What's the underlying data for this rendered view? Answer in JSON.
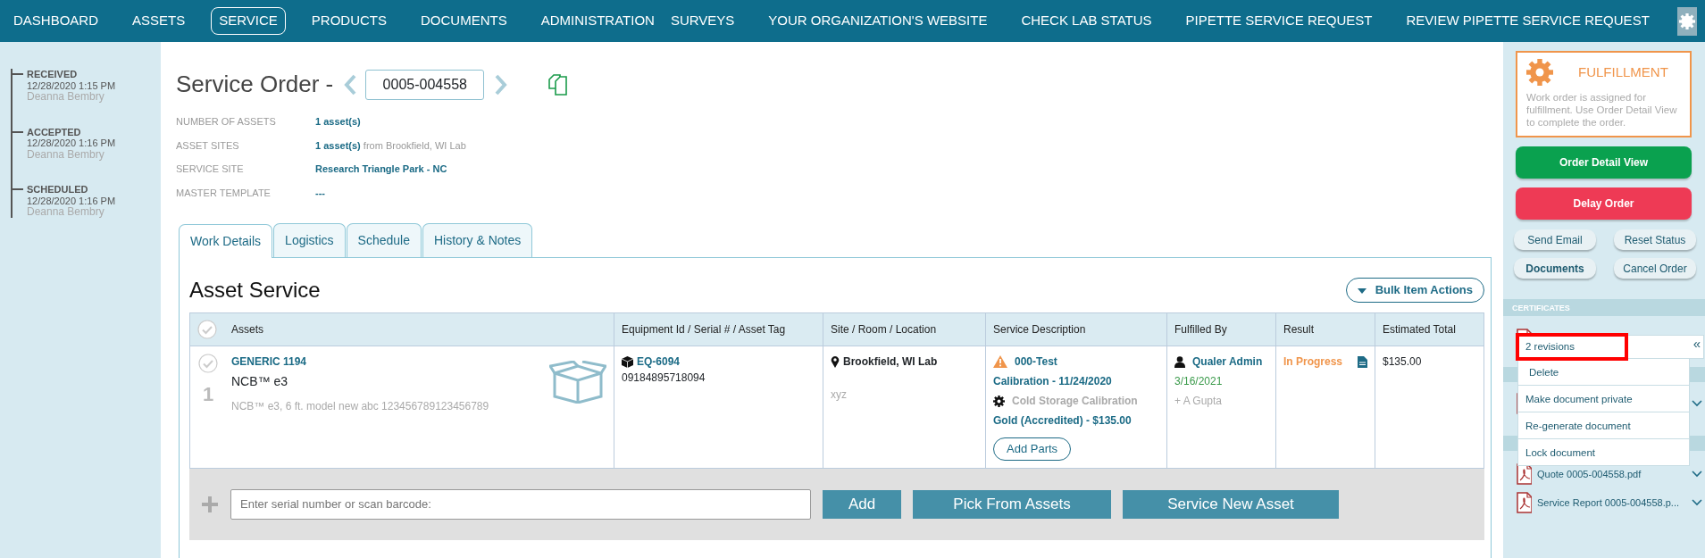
{
  "nav": {
    "left_items": [
      {
        "label": "DASHBOARD",
        "selected": false
      },
      {
        "label": "ASSETS",
        "selected": false
      },
      {
        "label": "SERVICE",
        "selected": true
      },
      {
        "label": "PRODUCTS",
        "selected": false
      },
      {
        "label": "DOCUMENTS",
        "selected": false
      },
      {
        "label": "ADMINISTRATION",
        "selected": false
      }
    ],
    "right_items": [
      {
        "label": "SURVEYS",
        "selected": false
      },
      {
        "label": "YOUR ORGANIZATION'S WEBSITE",
        "selected": false
      },
      {
        "label": "CHECK LAB STATUS",
        "selected": false
      },
      {
        "label": "PIPETTE SERVICE REQUEST",
        "selected": false
      },
      {
        "label": "REVIEW PIPETTE SERVICE REQUEST",
        "selected": false
      }
    ]
  },
  "timeline": [
    {
      "status": "RECEIVED",
      "time": "12/28/2020 1:15 PM",
      "user": "Deanna Bembry"
    },
    {
      "status": "ACCEPTED",
      "time": "12/28/2020 1:16 PM",
      "user": "Deanna Bembry"
    },
    {
      "status": "SCHEDULED",
      "time": "12/28/2020 1:16 PM",
      "user": "Deanna Bembry"
    }
  ],
  "order": {
    "title": "Service Order -",
    "number": "0005-004558",
    "fields": [
      {
        "label": "NUMBER OF ASSETS",
        "value": "1 asset(s)"
      },
      {
        "label": "ASSET SITES",
        "value": "1 asset(s)",
        "note": "from Brookfield, WI Lab"
      },
      {
        "label": "SERVICE SITE",
        "value": "Research Triangle Park - NC"
      },
      {
        "label": "MASTER TEMPLATE",
        "value": "---"
      }
    ]
  },
  "tabs": [
    {
      "label": "Work Details",
      "selected": true
    },
    {
      "label": "Logistics",
      "selected": false
    },
    {
      "label": "Schedule",
      "selected": false
    },
    {
      "label": "History & Notes",
      "selected": false
    }
  ],
  "section_title": "Asset Service",
  "bulk_button": "Bulk Item Actions",
  "table": {
    "columns": [
      "Assets",
      "Equipment Id / Serial # / Asset Tag",
      "Site / Room / Location",
      "Service Description",
      "Fulfilled By",
      "Result",
      "Estimated Total"
    ],
    "rows": [
      {
        "index": "1",
        "name": "GENERIC 1194",
        "model": "NCB™ e3",
        "description": "NCB™ e3, 6 ft. model new abc 123456789123456789",
        "equipment_id": "EQ-6094",
        "serial": "09184895718094",
        "site": "Brookfield, WI Lab",
        "room": "xyz",
        "service": {
          "name": "000-Test",
          "schedule": "Calibration - 11/24/2020",
          "option": "Cold Storage Calibration",
          "price": "Gold (Accredited) - $135.00",
          "button": "Add Parts"
        },
        "fulfilled": {
          "name": "Qualer Admin",
          "date": "3/16/2021",
          "extra": "+ A Gupta"
        },
        "result": "In Progress",
        "total": "$135.00"
      }
    ]
  },
  "add_bar": {
    "placeholder": "Enter serial number or scan barcode:",
    "buttons": [
      "Add",
      "Pick From Assets",
      "Service New Asset"
    ]
  },
  "status_card": {
    "title": "FULFILLMENT",
    "text": "Work order is assigned for fulfillment. Use Order Detail View to complete the order."
  },
  "primary_actions": [
    {
      "label": "Order Detail View",
      "kind": "go"
    },
    {
      "label": "Delay Order",
      "kind": "stop"
    }
  ],
  "secondary_actions": [
    {
      "label": "Send Email",
      "bold": false
    },
    {
      "label": "Reset Status",
      "bold": false
    },
    {
      "label": "Documents",
      "bold": true
    },
    {
      "label": "Cancel Order",
      "bold": false
    }
  ],
  "documents": {
    "header": "CERTIFICATES",
    "files": [
      {
        "name": "Quote 0005-004558.pdf"
      },
      {
        "name": "Service Report 0005-004558.p..."
      }
    ]
  },
  "document_menu": {
    "collapse": "«",
    "items": [
      {
        "label": "2 revisions",
        "highlighted": true
      },
      {
        "label": "Delete",
        "highlighted": false
      },
      {
        "label": "Make document private",
        "highlighted": false
      },
      {
        "label": "Re-generate document",
        "highlighted": false
      },
      {
        "label": "Lock document",
        "highlighted": false
      }
    ]
  }
}
